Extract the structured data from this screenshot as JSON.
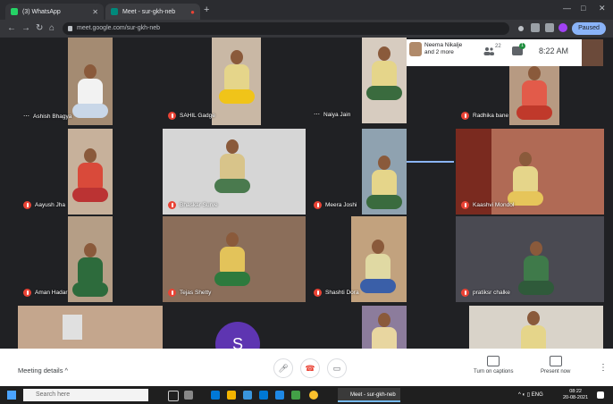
{
  "browser": {
    "tabs": [
      {
        "label": "(3) WhatsApp",
        "favicon_color": "#25d366"
      },
      {
        "label": "Meet - sur-gkh-neb",
        "favicon_color": "#00897b"
      }
    ],
    "new_tab_label": "+",
    "url": "meet.google.com/sur-gkh-neb",
    "profile_label": "Paused"
  },
  "meeting": {
    "tiles": [
      {
        "name": "Ashish Bhagya",
        "muted": false
      },
      {
        "name": "SAHIL Gadge",
        "muted": true
      },
      {
        "name": "Naiya Jain",
        "muted": false
      },
      {
        "name": "Radhika bane",
        "muted": true
      },
      {
        "name": "Aayush Jha",
        "muted": true
      },
      {
        "name": "Bhaskar Surve",
        "muted": true
      },
      {
        "name": "Meera Joshi",
        "muted": true
      },
      {
        "name": "Kaashvi Mondol",
        "muted": true
      },
      {
        "name": "Aman Hadar",
        "muted": true
      },
      {
        "name": "Tejas Shetty",
        "muted": true
      },
      {
        "name": "Shashti Dora",
        "muted": true
      },
      {
        "name": "pratiksr chalke",
        "muted": true
      }
    ],
    "avatar_initial": "S",
    "top_info": {
      "presenter": "Neema Nikalje and 2 more",
      "participants_count": "22",
      "chat_count": "1",
      "time": "8:22 AM"
    },
    "bottom": {
      "meeting_details": "Meeting details ^",
      "captions": "Turn on captions",
      "present": "Present now"
    }
  },
  "taskbar": {
    "search_placeholder": "Search here",
    "app_label": "Meet - sur-gkh-neb",
    "time": "08:22",
    "date": "20-08-2021"
  }
}
